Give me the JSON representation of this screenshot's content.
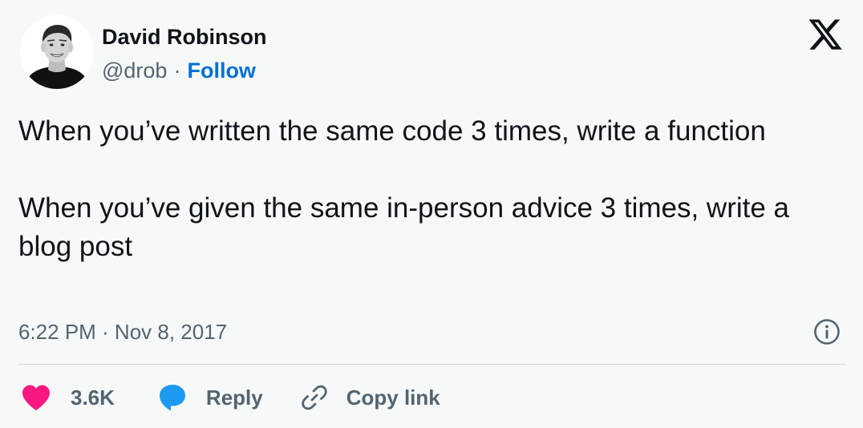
{
  "author": {
    "name": "David Robinson",
    "handle": "@drob",
    "separator": "·",
    "follow_label": "Follow"
  },
  "tweet": {
    "paragraphs": [
      "When you’ve written the same code 3 times, write a function",
      "When you’ve given the same in-person advice 3 times, write a blog post"
    ],
    "timestamp": "6:22 PM · Nov 8, 2017"
  },
  "actions": {
    "likes_count": "3.6K",
    "reply_label": "Reply",
    "copy_link_label": "Copy link"
  },
  "icons": {
    "logo": "x-logo-icon",
    "info": "info-icon",
    "like": "heart-icon",
    "reply": "speech-bubble-icon",
    "copy": "link-icon"
  },
  "colors": {
    "background": "#f7f9f9",
    "text_primary": "#0f1419",
    "text_secondary": "#536471",
    "follow_blue": "#006fd6",
    "heart_pink": "#f91880",
    "reply_blue": "#1d9bf0",
    "divider": "#cfd9de"
  }
}
